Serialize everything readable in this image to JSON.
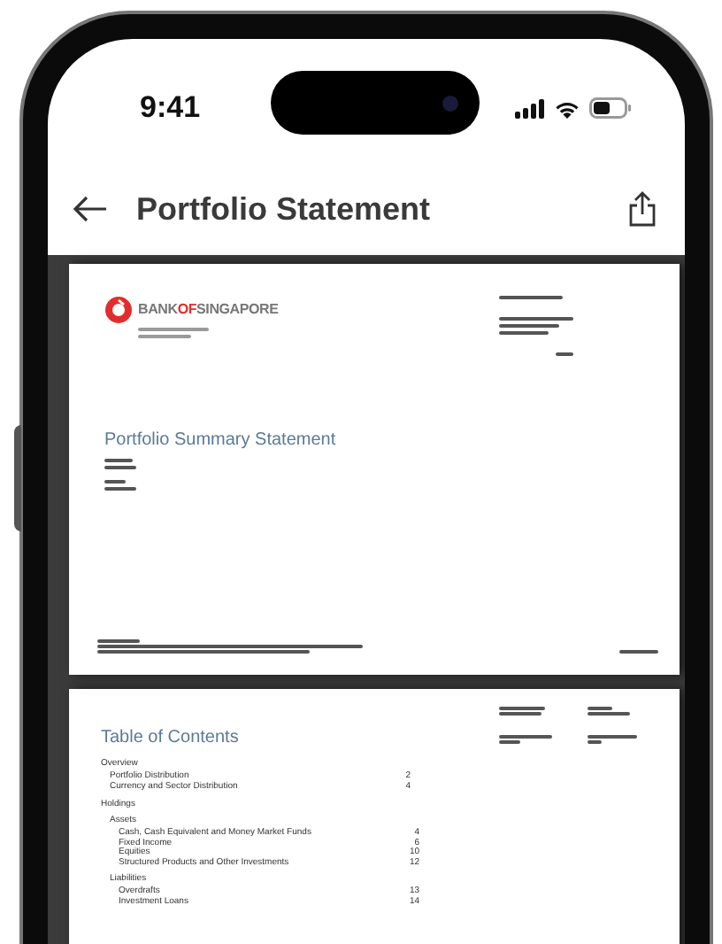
{
  "status_bar": {
    "time": "9:41"
  },
  "nav": {
    "title": "Portfolio Statement"
  },
  "cover_page": {
    "logo": [
      {
        "text": "BANK",
        "accent": false
      },
      {
        "text": "OF",
        "accent": true
      },
      {
        "text": "SINGAPORE",
        "accent": false
      }
    ],
    "heading": "Portfolio Summary Statement"
  },
  "contents_page": {
    "heading": "Table of Contents",
    "sections": [
      {
        "label": "Overview",
        "children": [
          {
            "label": "Portfolio Distribution",
            "page": "2"
          },
          {
            "label": "Currency and Sector Distribution",
            "page": "4"
          }
        ]
      },
      {
        "label": "Holdings",
        "children": [
          {
            "label": "Assets",
            "children": [
              {
                "label": "Cash, Cash Equivalent and Money Market Funds",
                "page": "4"
              },
              {
                "label": "Fixed Income",
                "page": "6"
              },
              {
                "label": "Equities",
                "page": "10"
              },
              {
                "label": "Structured Products and Other Investments",
                "page": "12"
              }
            ]
          },
          {
            "label": "Liabilities",
            "children": [
              {
                "label": "Overdrafts",
                "page": "13"
              },
              {
                "label": "Investment Loans",
                "page": "14"
              }
            ]
          }
        ]
      }
    ]
  }
}
